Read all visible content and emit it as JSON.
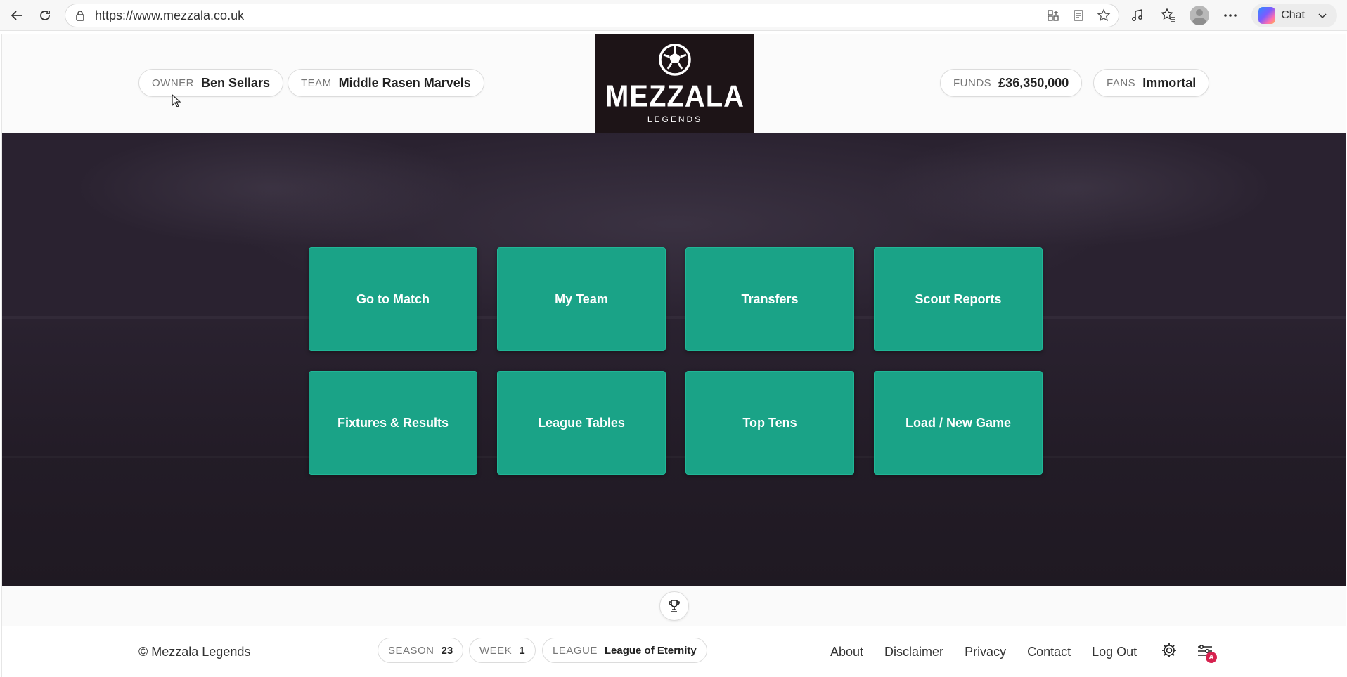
{
  "browser": {
    "url": "https://www.mezzala.co.uk",
    "chat_label": "Chat"
  },
  "header": {
    "owner": {
      "label": "OWNER",
      "value": "Ben Sellars"
    },
    "team": {
      "label": "TEAM",
      "value": "Middle Rasen Marvels"
    },
    "funds": {
      "label": "FUNDS",
      "value": "£36,350,000"
    },
    "fans": {
      "label": "FANS",
      "value": "Immortal"
    },
    "logo_word": "MEZZALA",
    "logo_sub": "LEGENDS"
  },
  "menu": {
    "tiles": [
      {
        "label": "Go to Match"
      },
      {
        "label": "My Team"
      },
      {
        "label": "Transfers"
      },
      {
        "label": "Scout Reports"
      },
      {
        "label": "Fixtures & Results"
      },
      {
        "label": "League Tables"
      },
      {
        "label": "Top Tens"
      },
      {
        "label": "Load / New Game"
      }
    ]
  },
  "footer": {
    "copyright": "© Mezzala Legends",
    "season": {
      "label": "SEASON",
      "value": "23"
    },
    "week": {
      "label": "WEEK",
      "value": "1"
    },
    "league": {
      "label": "LEAGUE",
      "value": "League of Eternity"
    },
    "links": [
      {
        "label": "About"
      },
      {
        "label": "Disclaimer"
      },
      {
        "label": "Privacy"
      },
      {
        "label": "Contact"
      },
      {
        "label": "Log Out"
      }
    ],
    "notification_badge": "A"
  },
  "colors": {
    "tile": "#1aa387",
    "hero_bg": "#2a2230",
    "logo_bg": "#1d1417",
    "badge": "#d6224f"
  }
}
